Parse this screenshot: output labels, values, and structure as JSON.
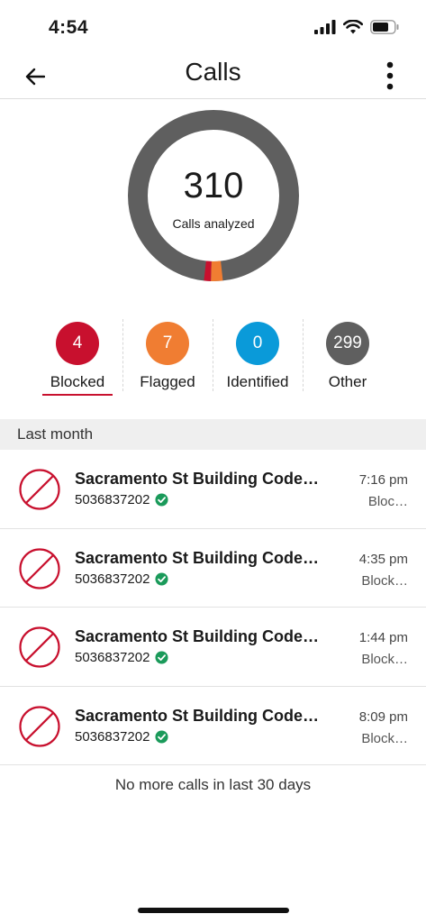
{
  "status_bar": {
    "time": "4:54",
    "icons": [
      "cellular-signal-icon",
      "wifi-icon",
      "battery-icon"
    ]
  },
  "header": {
    "title": "Calls",
    "back_icon": "arrow-left-icon",
    "menu_icon": "more-vertical-icon"
  },
  "summary": {
    "total": "310",
    "label": "Calls analyzed",
    "colors": {
      "other": "#5f5f5f",
      "flagged": "#f07d32",
      "blocked": "#c8102e",
      "identified": "#0a9ad9"
    }
  },
  "filters": [
    {
      "count": "4",
      "label": "Blocked",
      "color": "#c8102e",
      "selected": true
    },
    {
      "count": "7",
      "label": "Flagged",
      "color": "#f07d32",
      "selected": false
    },
    {
      "count": "0",
      "label": "Identified",
      "color": "#0a9ad9",
      "selected": false
    },
    {
      "count": "299",
      "label": "Other",
      "color": "#5f5f5f",
      "selected": false
    }
  ],
  "section": {
    "title": "Last month"
  },
  "calls": [
    {
      "name": "Sacramento St Building Code…",
      "number": "5036837202",
      "time": "7:16 pm",
      "status": "Bloc…",
      "icon": "blocked-icon",
      "verified_icon": "verified-check-icon"
    },
    {
      "name": "Sacramento St Building Code…",
      "number": "5036837202",
      "time": "4:35 pm",
      "status": "Block…",
      "icon": "blocked-icon",
      "verified_icon": "verified-check-icon"
    },
    {
      "name": "Sacramento St Building Code…",
      "number": "5036837202",
      "time": "1:44 pm",
      "status": "Block…",
      "icon": "blocked-icon",
      "verified_icon": "verified-check-icon"
    },
    {
      "name": "Sacramento St Building Code…",
      "number": "5036837202",
      "time": "8:09 pm",
      "status": "Block…",
      "icon": "blocked-icon",
      "verified_icon": "verified-check-icon"
    }
  ],
  "footer": {
    "note": "No more calls in last 30 days"
  },
  "accent_color": "#c8102e",
  "verified_color": "#1a9a5a"
}
